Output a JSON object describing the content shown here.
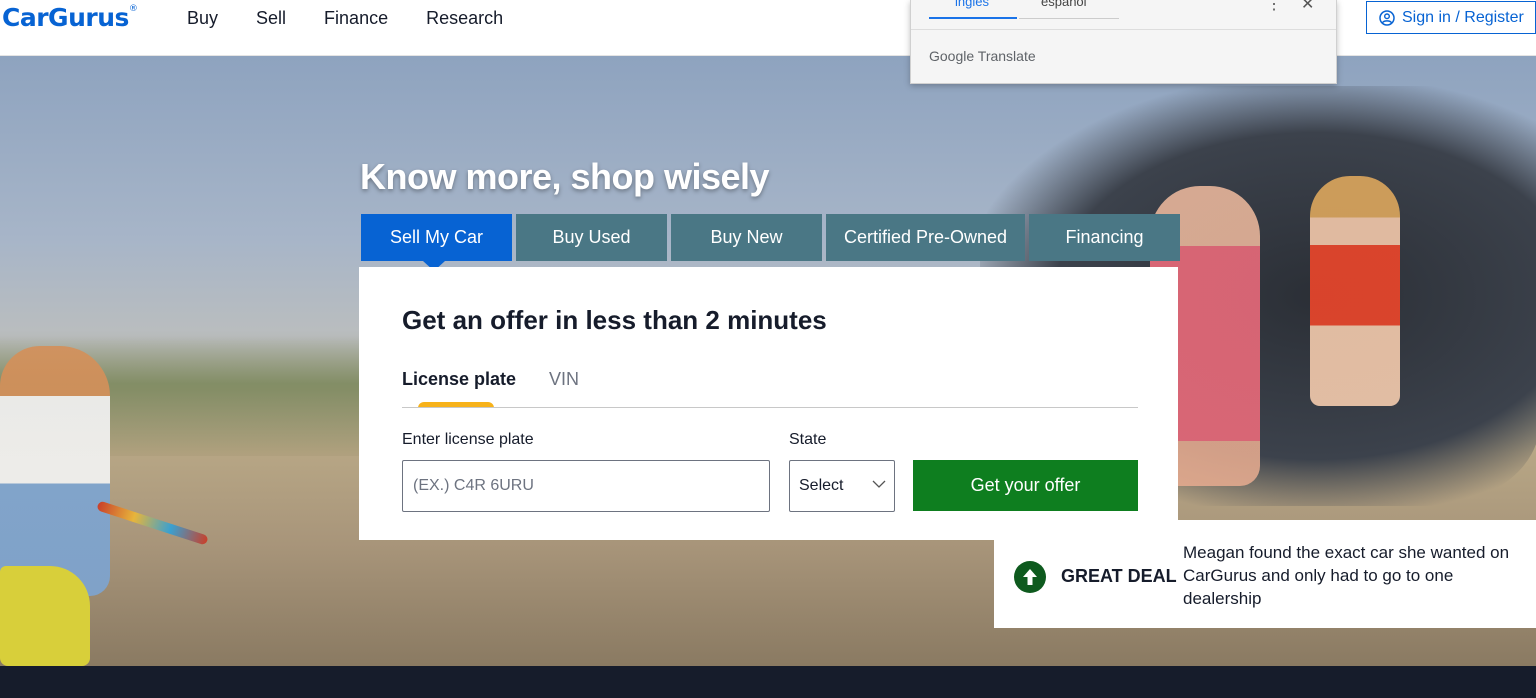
{
  "header": {
    "logo": "CarGurus",
    "logo_mark": "®",
    "nav": [
      "Buy",
      "Sell",
      "Finance",
      "Research"
    ],
    "signin_label": "Sign in / Register"
  },
  "translate_popup": {
    "lang_1": "inglés",
    "lang_2": "español",
    "brand": "Google Translate",
    "menu_glyph": "⋮",
    "close_glyph": "✕"
  },
  "hero": {
    "title": "Know more, shop wisely",
    "tabs": [
      "Sell My Car",
      "Buy Used",
      "Buy New",
      "Certified Pre-Owned",
      "Financing"
    ],
    "active_tab": "Sell My Car"
  },
  "offer_card": {
    "title": "Get an offer in less than 2 minutes",
    "sub_tabs": [
      "License plate",
      "VIN"
    ],
    "plate_label": "Enter license plate",
    "plate_placeholder": "(EX.) C4R 6URU",
    "plate_value": "",
    "state_label": "State",
    "state_value": "Select",
    "submit_label": "Get your offer"
  },
  "deal": {
    "label": "GREAT DEAL",
    "text": "Meagan found the exact car she wanted on CarGurus and only had to go to one dealership"
  },
  "colors": {
    "brand_blue": "#0763d3",
    "tab_teal": "#4a7785",
    "cta_green": "#0e7e1f",
    "accent_yellow": "#f7b21a",
    "dark_navy": "#161c2b"
  }
}
